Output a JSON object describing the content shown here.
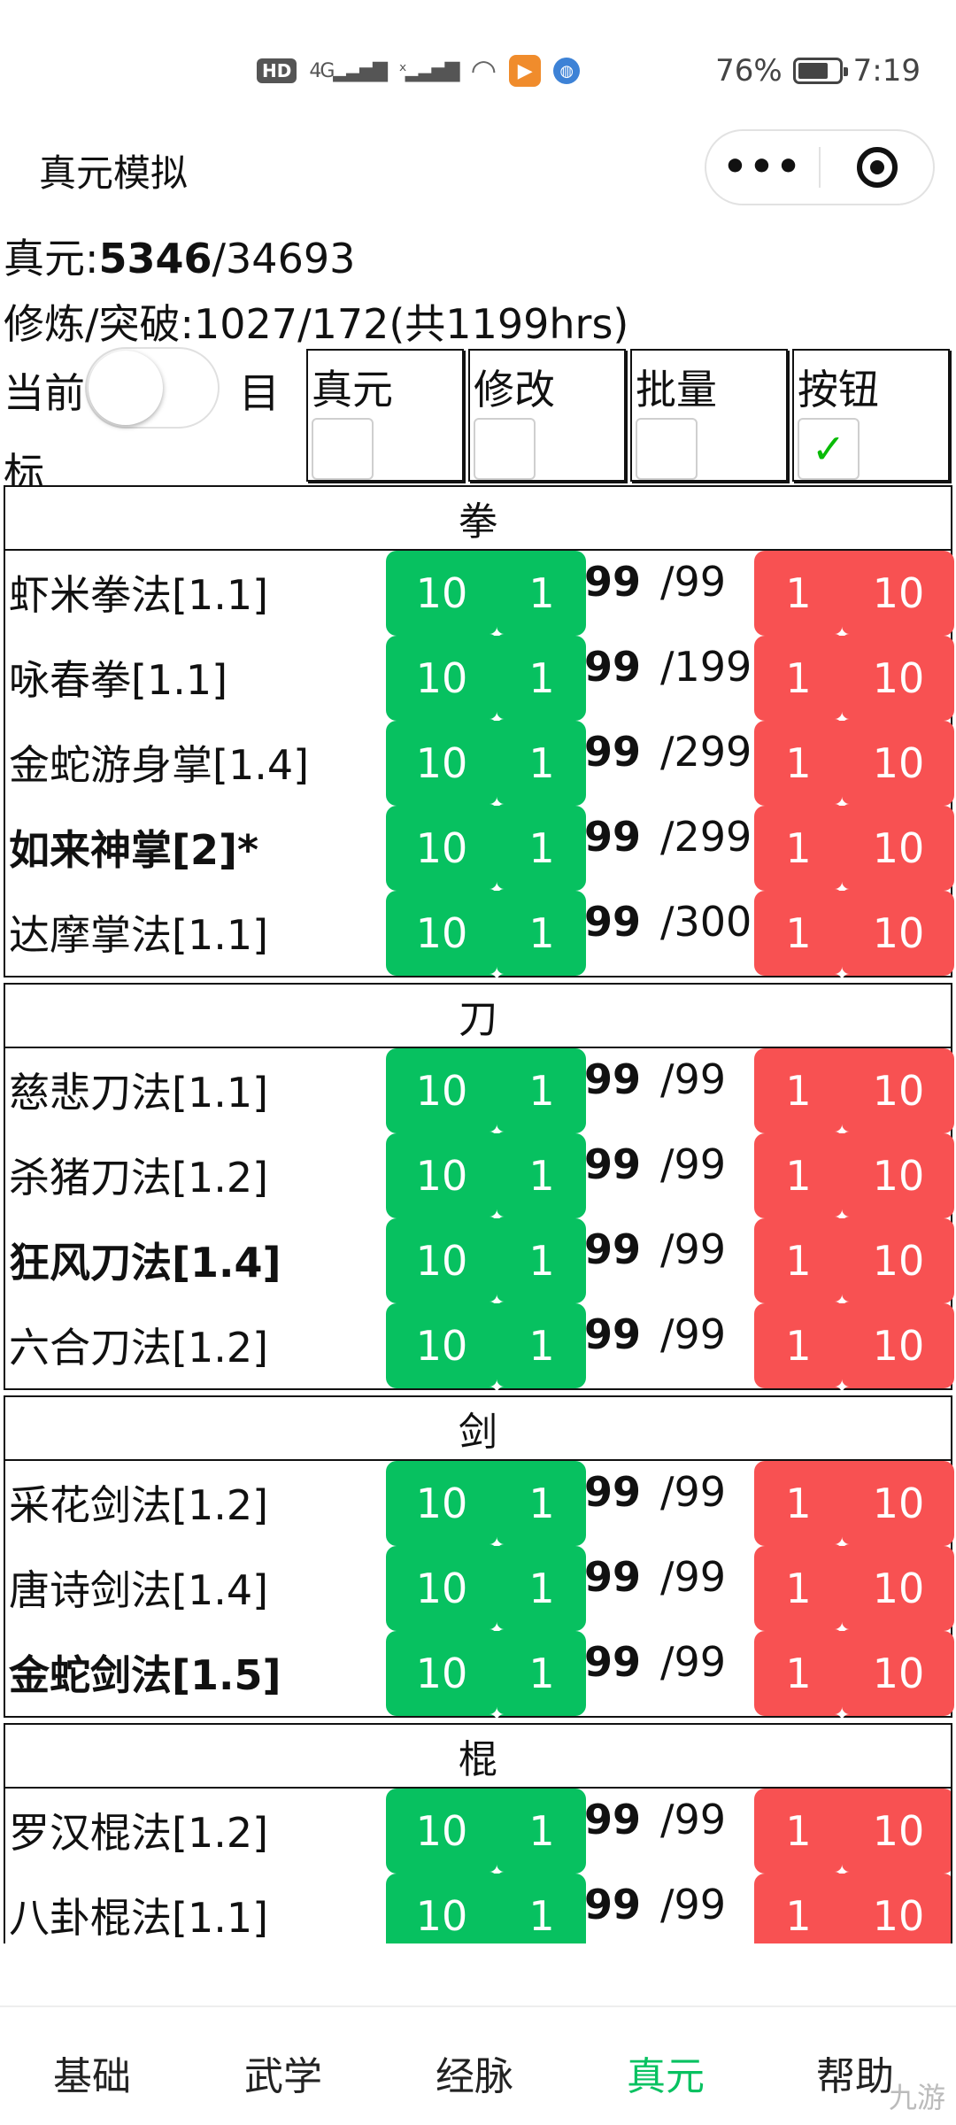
{
  "status_bar": {
    "hd_label": "HD",
    "net_label": "4G",
    "battery_percent": "76%",
    "battery_level": 0.76,
    "time": "7:19"
  },
  "title_bar": {
    "title": "真元模拟",
    "menu_icon": "more-dots-icon",
    "close_icon": "target-circle-icon"
  },
  "summary": {
    "zhenyuan_label": "真元:",
    "zhenyuan_current": "5346",
    "zhenyuan_total": "/34693",
    "train_label": "修炼/突破:",
    "train_values": "1027/172(共1199hrs)"
  },
  "mode": {
    "current_label": "当前",
    "target_label_1": "目",
    "target_label_2": "标",
    "toggle_on": false,
    "options": [
      {
        "label": "真元",
        "checked": false
      },
      {
        "label": "修改",
        "checked": false
      },
      {
        "label": "批量",
        "checked": false
      },
      {
        "label": "按钮",
        "checked": true
      }
    ],
    "check_mark": "✓"
  },
  "buttons": {
    "inc10": "10",
    "inc1": "1",
    "dec1": "1",
    "dec10": "10"
  },
  "sections": [
    {
      "title": "拳",
      "rows": [
        {
          "name": "虾米拳法[1.1]",
          "bold": false,
          "current": "99",
          "max": "/99"
        },
        {
          "name": "咏春拳[1.1]",
          "bold": false,
          "current": "99",
          "max": "/199"
        },
        {
          "name": "金蛇游身掌[1.4]",
          "bold": false,
          "current": "99",
          "max": "/299"
        },
        {
          "name": "如来神掌[2]*",
          "bold": true,
          "current": "99",
          "max": "/299"
        },
        {
          "name": "达摩掌法[1.1]",
          "bold": false,
          "current": "99",
          "max": "/300"
        }
      ]
    },
    {
      "title": "刀",
      "rows": [
        {
          "name": "慈悲刀法[1.1]",
          "bold": false,
          "current": "99",
          "max": "/99"
        },
        {
          "name": "杀猪刀法[1.2]",
          "bold": false,
          "current": "99",
          "max": "/99"
        },
        {
          "name": "狂风刀法[1.4]",
          "bold": true,
          "current": "99",
          "max": "/99"
        },
        {
          "name": "六合刀法[1.2]",
          "bold": false,
          "current": "99",
          "max": "/99"
        }
      ]
    },
    {
      "title": "剑",
      "rows": [
        {
          "name": "采花剑法[1.2]",
          "bold": false,
          "current": "99",
          "max": "/99"
        },
        {
          "name": "唐诗剑法[1.4]",
          "bold": false,
          "current": "99",
          "max": "/99"
        },
        {
          "name": "金蛇剑法[1.5]",
          "bold": true,
          "current": "99",
          "max": "/99"
        }
      ]
    },
    {
      "title": "棍",
      "rows": [
        {
          "name": "罗汉棍法[1.2]",
          "bold": false,
          "current": "99",
          "max": "/99"
        },
        {
          "name": "八卦棍法[1.1]",
          "bold": false,
          "current": "99",
          "max": "/99"
        }
      ]
    }
  ],
  "bottom_nav": {
    "tabs": [
      {
        "label": "基础",
        "active": false
      },
      {
        "label": "武学",
        "active": false
      },
      {
        "label": "经脉",
        "active": false
      },
      {
        "label": "真元",
        "active": true
      },
      {
        "label": "帮助",
        "active": false
      }
    ]
  },
  "watermark": "九游",
  "colors": {
    "green": "#07c160",
    "red": "#f85152",
    "check_green": "#09bb07"
  }
}
